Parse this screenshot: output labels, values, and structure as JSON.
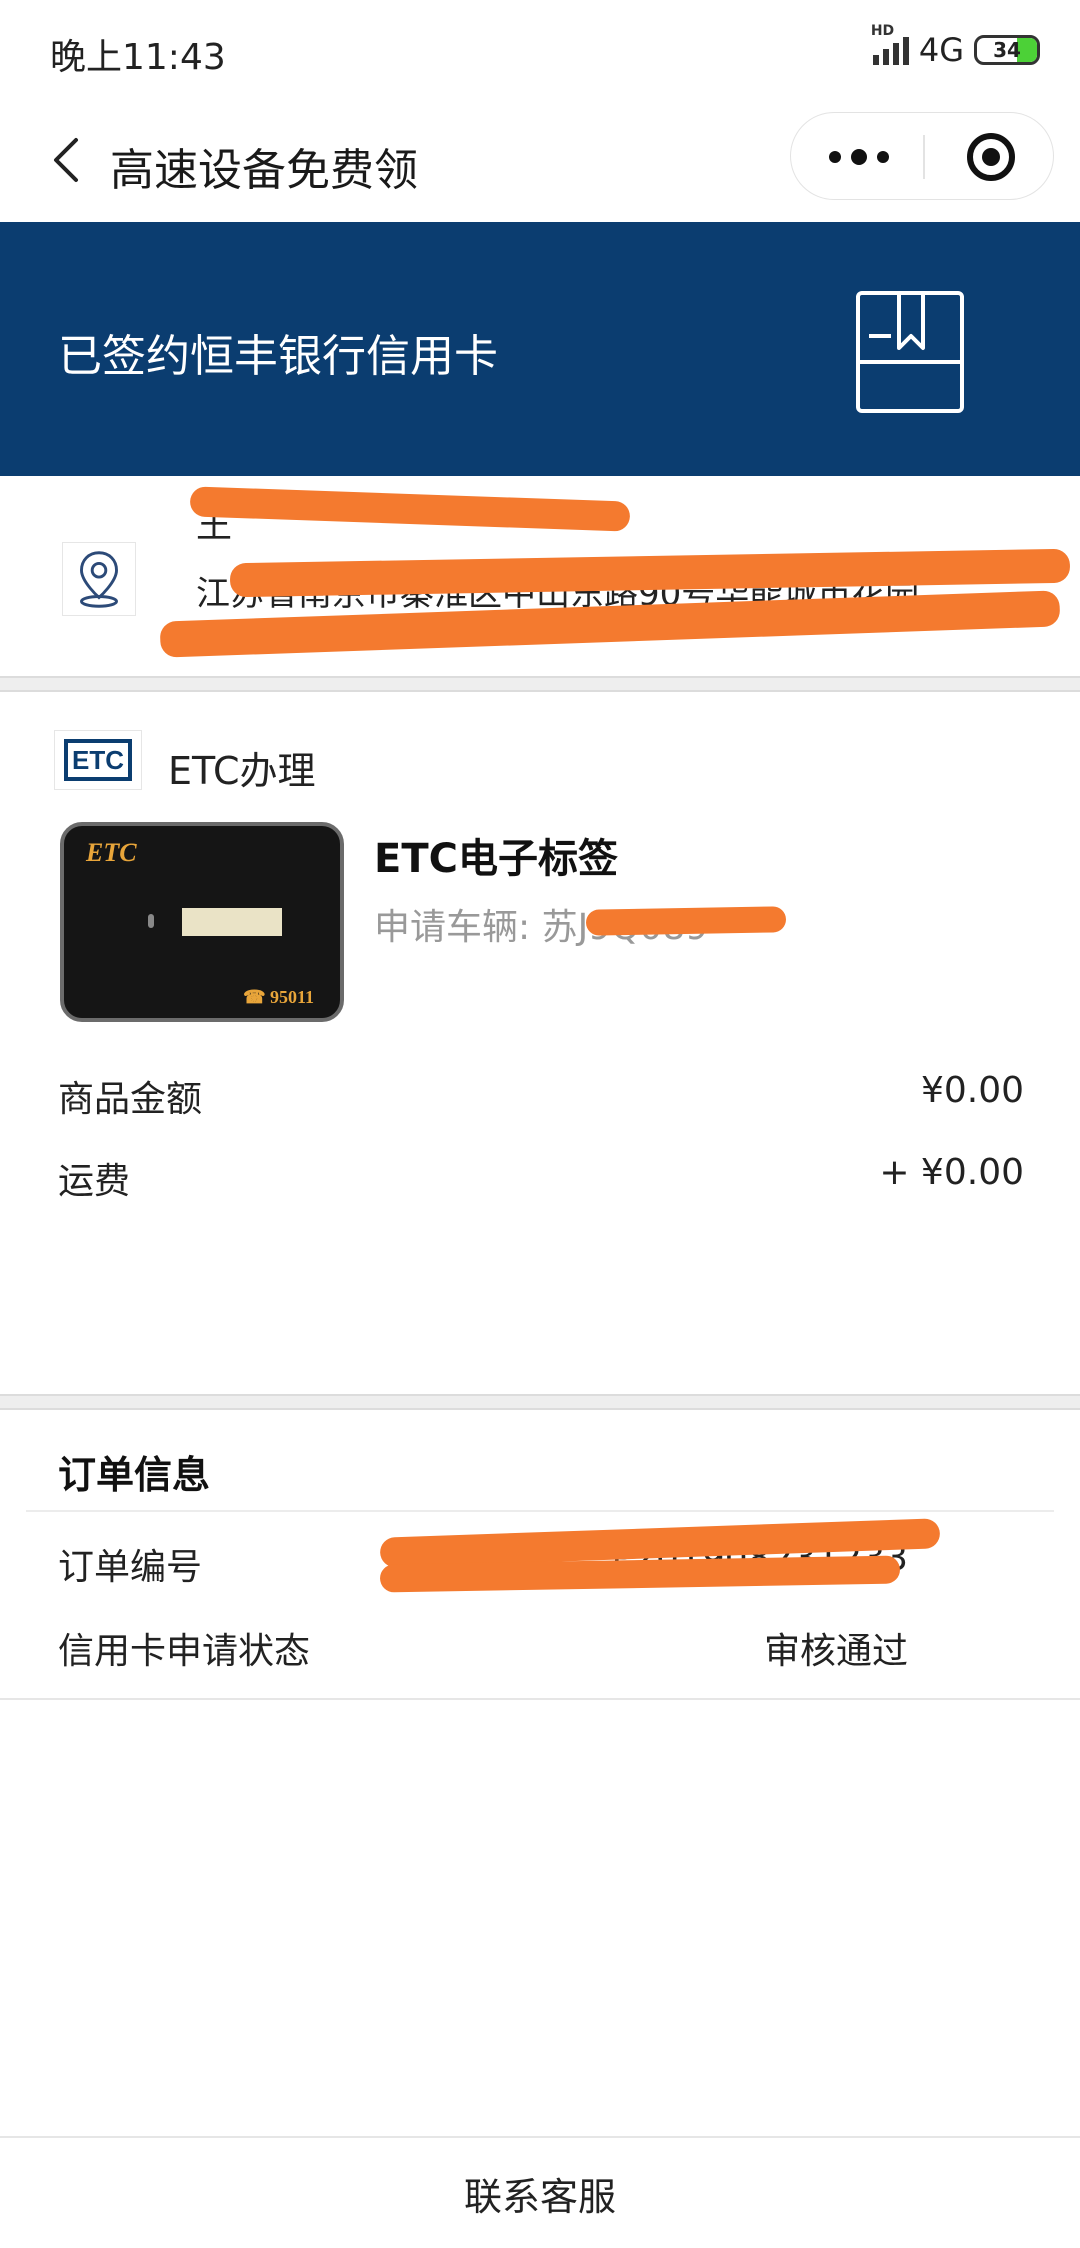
{
  "status_bar": {
    "time": "晚上11:43",
    "network": "4G",
    "hd": "HD",
    "battery_level": "34",
    "battery_fill_percent": 34,
    "battery_color": "#4cd137"
  },
  "nav": {
    "title": "高速设备免费领",
    "icons": [
      "back-icon",
      "more-icon",
      "target-icon"
    ]
  },
  "banner": {
    "title": "已签约恒丰银行信用卡",
    "background": "#0b3d70",
    "icon": "bookmark-book-icon"
  },
  "address": {
    "name_partial": "王",
    "line_partial": "江苏省南京市秦淮区中山东路90号华能城市花园",
    "icon": "location-pin-icon",
    "redacted": true
  },
  "product": {
    "store_label": "ETC办理",
    "store_logo": "ETC",
    "image_brand": "ETC",
    "image_phone": "☎ 95011",
    "name": "ETC电子标签",
    "vehicle_label": "申请车辆: ",
    "vehicle_value": "苏J9Q089"
  },
  "pricing": {
    "goods_label": "商品金额",
    "goods_value": "¥0.00",
    "shipping_label": "运费",
    "shipping_value": "+ ¥0.00"
  },
  "order": {
    "title": "订单信息",
    "number_label": "订单编号",
    "number_value": "P201908231233",
    "status_label": "信用卡申请状态",
    "status_value": "审核通过"
  },
  "footer": {
    "contact_label": "联系客服"
  },
  "colors": {
    "redaction": "#f47a2f",
    "brand_navy": "#0b3d70"
  }
}
